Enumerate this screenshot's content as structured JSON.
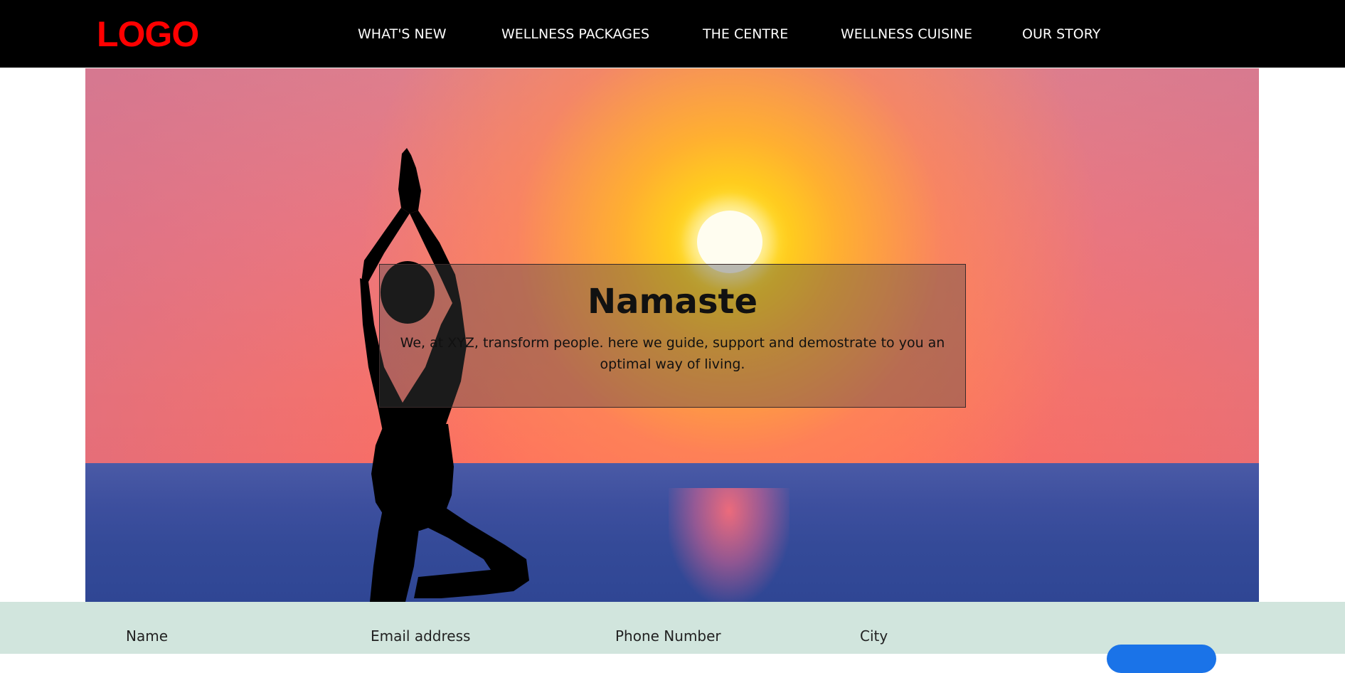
{
  "header": {
    "logo": "LOGO",
    "nav": [
      {
        "label": "WHAT'S NEW"
      },
      {
        "label": "WELLNESS PACKAGES"
      },
      {
        "label": "THE CENTRE"
      },
      {
        "label": "WELLNESS CUISINE"
      },
      {
        "label": "OUR STORY"
      }
    ]
  },
  "hero": {
    "title": "Namaste",
    "text": "We, at XYZ, transform people. here we guide, support and demostrate to you an optimal way of living."
  },
  "form": {
    "name_label": "Name",
    "email_label": "Email address",
    "phone_label": "Phone Number",
    "city_label": "City"
  },
  "colors": {
    "topbar": "#000000",
    "logo": "#ff0000",
    "form_strip": "#d1e5dd",
    "submit_button": "#1a73e8"
  }
}
